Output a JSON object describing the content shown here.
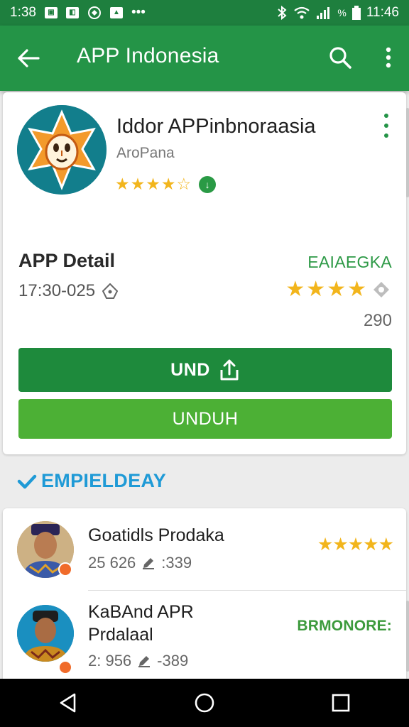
{
  "status_bar": {
    "time_left": "1:38",
    "time_right": "11:46",
    "battery_label": "%"
  },
  "app_bar": {
    "title": "APP Indonesia",
    "back_icon": "arrow-left-icon",
    "search_icon": "search-icon",
    "menu_icon": "more-vert-icon"
  },
  "app": {
    "name": "Iddor APPinbnoraasia",
    "developer": "AroPana",
    "rating_stars": 4,
    "rating_max": 5
  },
  "detail": {
    "title": "APP Detail",
    "date": "17:30-025",
    "badge": "EAIAEGKA",
    "rating_stars": 4,
    "count": "290",
    "primary_button": "UND",
    "secondary_button": "UNDUH"
  },
  "section": {
    "title": "EMPIELDEAY"
  },
  "list": {
    "items": [
      {
        "title": "Goatidls Prodaka",
        "subtitle": "",
        "meta_left": "25 626",
        "meta_right": ":339",
        "rating_stars": 5,
        "label": ""
      },
      {
        "title": "KaBAnd APR",
        "subtitle": "Prdalaal",
        "meta_left": "2: 956",
        "meta_right": "-389",
        "rating_stars": 0,
        "label": "BRMONORE:"
      }
    ]
  },
  "colors": {
    "primary_dark": "#1e7f3e",
    "primary": "#249447",
    "button_dark": "#1e8a3c",
    "button_light": "#4cb035",
    "star": "#f2b51c",
    "accent_blue": "#1f9ad6",
    "badge_green": "#2e9a47"
  }
}
